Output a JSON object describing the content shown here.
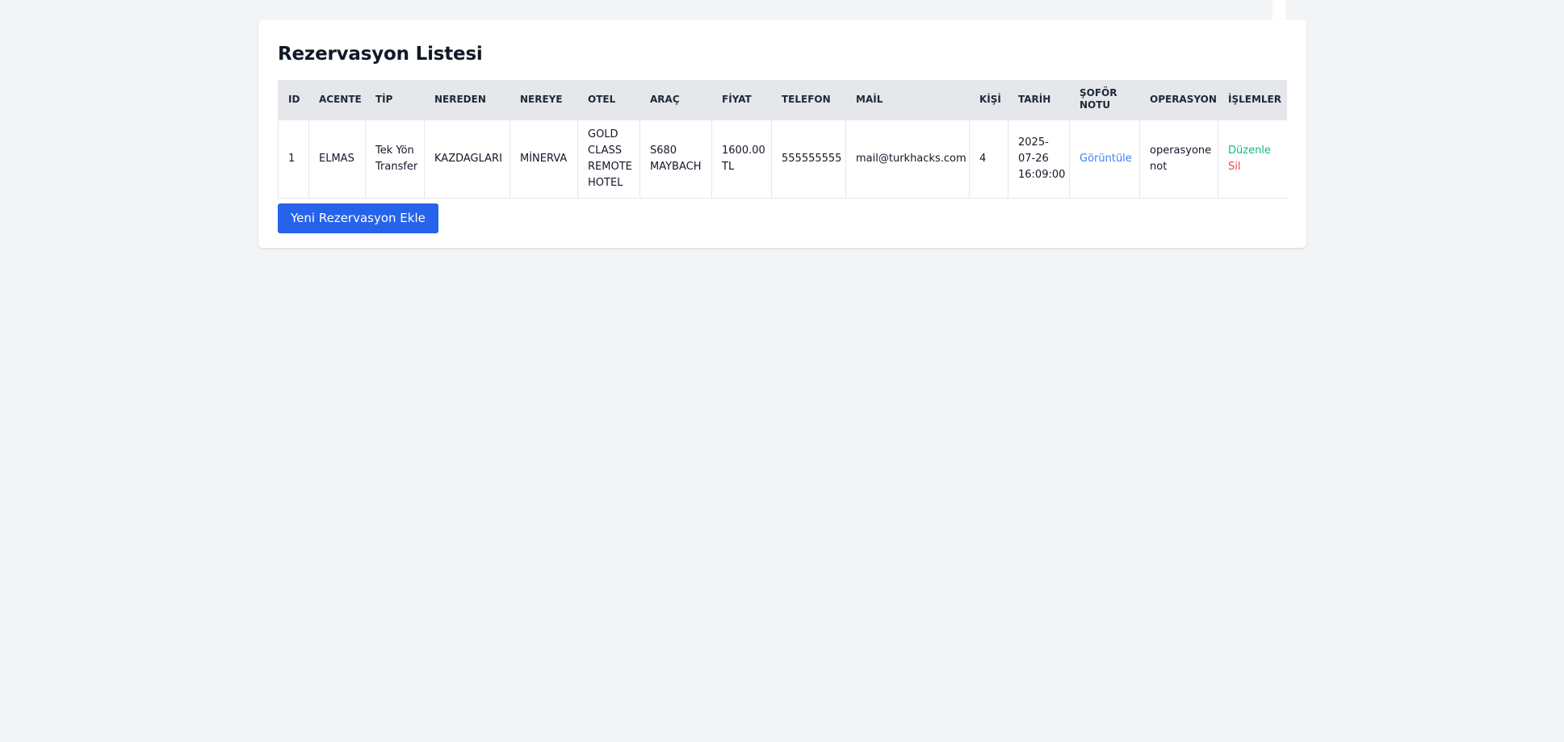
{
  "page": {
    "title": "Rezervasyon Listesi"
  },
  "table": {
    "headers": {
      "id": "ID",
      "acente": "ACENTE",
      "tip": "TİP",
      "nereden": "NEREDEN",
      "nereye": "NEREYE",
      "otel": "OTEL",
      "arac": "ARAÇ",
      "fiyat": "FİYAT",
      "telefon": "TELEFON",
      "mail": "MAİL",
      "kisi": "KİŞİ",
      "tarih": "TARİH",
      "sofor_notu": "ŞOFÖR NOTU",
      "operasyon": "OPERASYON",
      "islemler": "İŞLEMLER"
    },
    "rows": [
      {
        "id": "1",
        "acente": "ELMAS",
        "tip": "Tek Yön Transfer",
        "nereden": "KAZDAGLARI",
        "nereye": "MİNERVA",
        "otel": "GOLD CLASS REMOTE HOTEL",
        "arac": "S680 MAYBACH",
        "fiyat": "1600.00 TL",
        "telefon": "555555555",
        "mail": "mail@turkhacks.com",
        "kisi": "4",
        "tarih": "2025-07-26 16:09:00",
        "sofor_notu_link": "Görüntüle",
        "operasyon": "operasyone not",
        "edit_label": "Düzenle",
        "delete_label": "Sil"
      }
    ]
  },
  "actions": {
    "add_label": "Yeni Rezervasyon Ekle"
  },
  "colors": {
    "accent": "#2563eb",
    "link": "#3b82f6",
    "edit": "#10b981",
    "delete": "#ef4444",
    "header_bg": "#e5e7eb",
    "page_bg": "#f3f4f6"
  }
}
